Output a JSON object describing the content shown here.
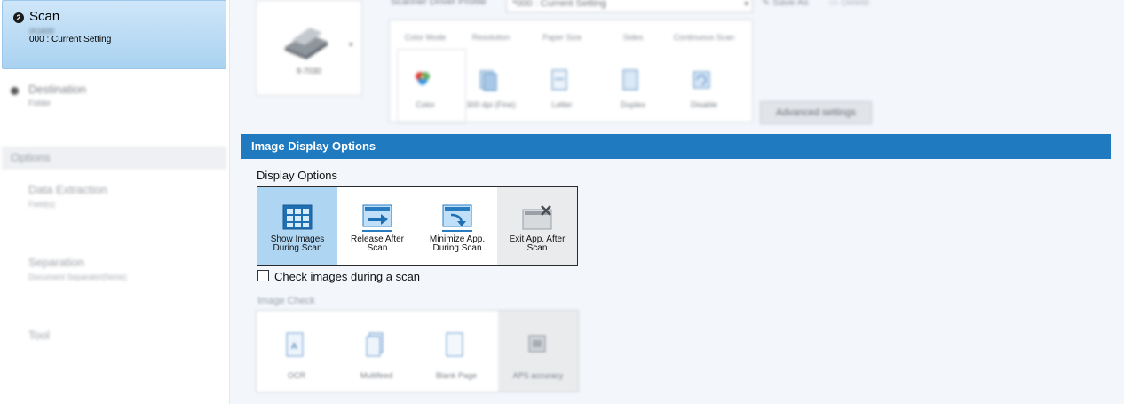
{
  "sidebar": {
    "scan": {
      "step": "2",
      "title": "Scan",
      "sub1": "iX1600",
      "sub2": "000 : Current Setting"
    },
    "destination": {
      "title": "Destination",
      "sub": "Folder"
    },
    "options_header": "Options",
    "items": [
      {
        "title": "Data Extraction",
        "sub": "Field(s)"
      },
      {
        "title": "Separation",
        "sub": "Document Separator(None)"
      },
      {
        "title": "Tool",
        "sub": ""
      }
    ]
  },
  "scanner": {
    "model": "fi-7030",
    "profile_label": "Scanner Driver Profile",
    "profile_value": "*000 : Current Setting",
    "save_as": "Save As",
    "delete": "Delete",
    "settings": [
      {
        "header": "Color Mode",
        "value": "Color"
      },
      {
        "header": "Resolution",
        "value": "300 dpi (Fine)"
      },
      {
        "header": "Paper Size",
        "value": "Letter"
      },
      {
        "header": "Sides",
        "value": "Duplex"
      },
      {
        "header": "Continuous Scan",
        "value": "Disable"
      }
    ],
    "advanced": "Advanced settings"
  },
  "image_display": {
    "section_title": "Image Display Options",
    "display_label": "Display Options",
    "options": [
      {
        "line1": "Show Images",
        "line2": "During Scan",
        "selected": true
      },
      {
        "line1": "Release After",
        "line2": "Scan",
        "selected": false
      },
      {
        "line1": "Minimize App.",
        "line2": "During Scan",
        "selected": false
      },
      {
        "line1": "Exit App. After",
        "line2": "Scan",
        "selected": false
      }
    ],
    "check_label": "Check images during a scan"
  },
  "image_check": {
    "label": "Image Check",
    "items": [
      "OCR",
      "Multifeed",
      "Blank Page",
      "APS accuracy"
    ]
  },
  "colors": {
    "accent": "#1f7ac0",
    "selected": "#aed6f3",
    "nav_selected": "#a9d2f1"
  }
}
